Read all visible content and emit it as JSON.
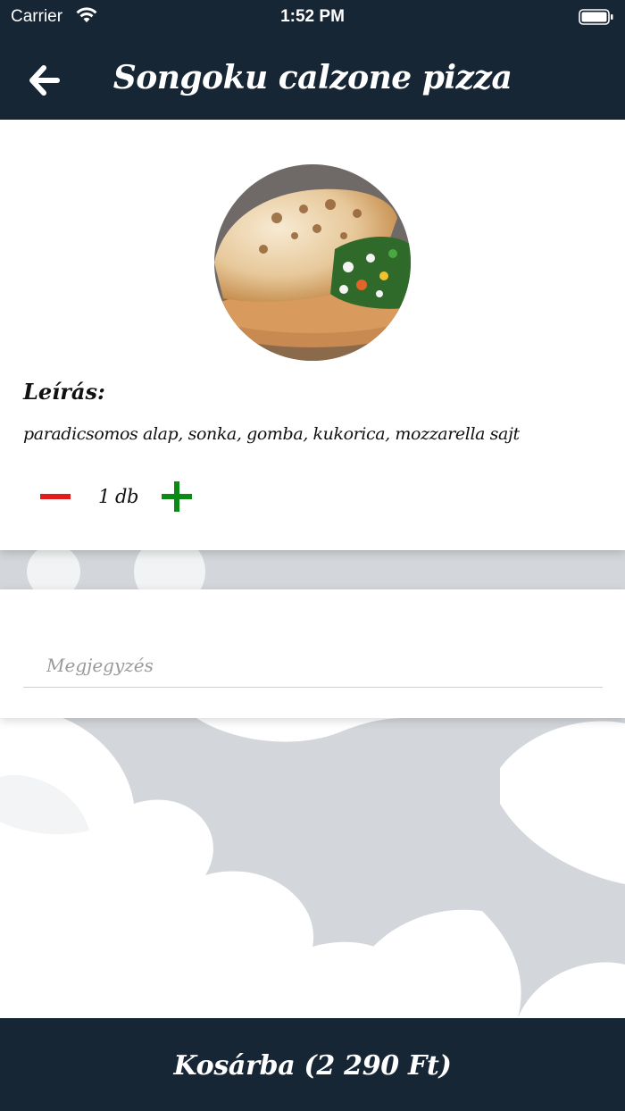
{
  "status_bar": {
    "carrier": "Carrier",
    "time": "1:52 PM"
  },
  "nav": {
    "back_icon": "arrow-left-icon",
    "title": "Songoku calzone pizza"
  },
  "product": {
    "image": "calzone-pizza-photo",
    "description_heading": "Leírás:",
    "description": "paradicsomos alap, sonka, gomba, kukorica, mozzarella sajt",
    "quantity_label": "1 db",
    "minus_icon": "minus-icon",
    "plus_icon": "plus-icon",
    "minus_color": "#e41b1b",
    "plus_color": "#0c8a16"
  },
  "note": {
    "placeholder": "Megjegyzés",
    "value": ""
  },
  "cart": {
    "button_label": "Kosárba (2 290 Ft)"
  },
  "colors": {
    "header": "#172634",
    "background": "#d3d6da"
  }
}
